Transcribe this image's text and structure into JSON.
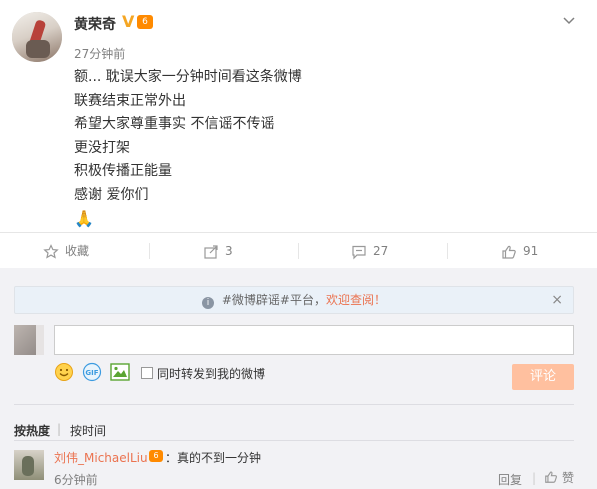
{
  "post": {
    "username": "黄荣奇",
    "verified_badge": "V",
    "vip_badge": "6",
    "timestamp": "27分钟前",
    "lines": [
      "额... 耽误大家一分钟时间看这条微博",
      "联赛结束正常外出",
      "希望大家尊重事实 不信谣不传谣",
      "更没打架",
      "积极传播正能量",
      "感谢 爱你们"
    ],
    "emoji": "🙏"
  },
  "actions": {
    "favorite_label": "收藏",
    "repost_count": "3",
    "comment_count": "27",
    "like_count": "91"
  },
  "comments": {
    "notice_prefix": "#微博辟谣#平台，",
    "notice_link": "欢迎查阅！",
    "input_value": "",
    "forward_label": "同时转发到我的微博",
    "submit_label": "评论",
    "sort_hot": "按热度",
    "sort_time": "按时间",
    "items": [
      {
        "name": "刘伟_MichaelLiu",
        "vip": "6",
        "text": "：真的不到一分钟",
        "time": "6分钟前",
        "reply_label": "回复",
        "like_label": "赞"
      }
    ]
  },
  "colors": {
    "accent": "#eb7350",
    "submit_bg": "#ffc09f",
    "panel_bg": "#f2f2f5",
    "notice_bg": "#eaf1f8"
  }
}
